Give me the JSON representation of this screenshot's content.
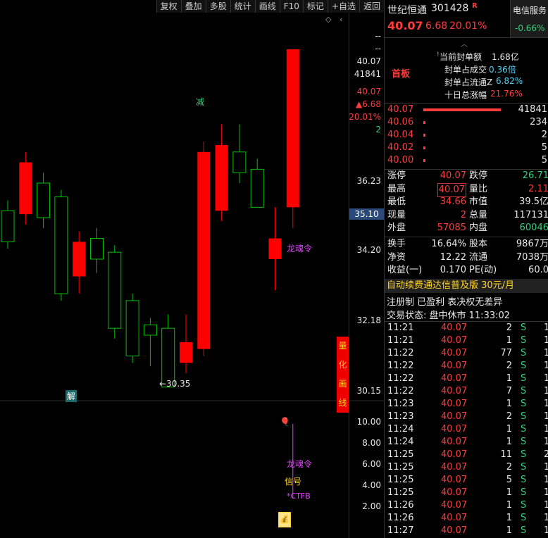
{
  "toolbar": {
    "items": [
      "复权",
      "叠加",
      "多股",
      "统计",
      "画线",
      "F10",
      "标记",
      "+自选",
      "返回"
    ]
  },
  "chart": {
    "axis_labels": [
      "--",
      "--",
      "40.07",
      "41841",
      "40.07",
      "▲6.68",
      "20.01%",
      "2",
      "36.23",
      "35.10",
      "34.20",
      "32.18",
      "30.15"
    ],
    "vol_axis": [
      "10.00",
      "8.00",
      "6.00",
      "4.00",
      "2.00"
    ],
    "annot_jian": "减",
    "annot_jie": "解",
    "low_marker": "←30.35",
    "dragon_label": "龙魂令",
    "dragon_label2": "龙魂令",
    "signal_label": "信号",
    "ctfb_label": "*CTFB",
    "quant_tag": [
      "量",
      "化",
      "画",
      "线"
    ],
    "colors": {
      "up": "#ff0000",
      "down": "#00c400",
      "bg": "#000000"
    }
  },
  "chart_data": {
    "type": "candlestick",
    "ylim": [
      30.15,
      40.07
    ],
    "candles": [
      {
        "o": 35.4,
        "c": 34.5,
        "h": 35.7,
        "l": 34.3
      },
      {
        "o": 35.3,
        "c": 36.8,
        "h": 37.1,
        "l": 35.0
      },
      {
        "o": 36.2,
        "c": 35.2,
        "h": 36.5,
        "l": 34.9
      },
      {
        "o": 35.8,
        "c": 33.0,
        "h": 36.0,
        "l": 32.8
      },
      {
        "o": 33.5,
        "c": 34.5,
        "h": 34.8,
        "l": 33.0
      },
      {
        "o": 34.6,
        "c": 34.0,
        "h": 34.9,
        "l": 33.6
      },
      {
        "o": 34.2,
        "c": 32.0,
        "h": 34.4,
        "l": 31.7
      },
      {
        "o": 32.8,
        "c": 31.2,
        "h": 33.0,
        "l": 31.0
      },
      {
        "o": 32.1,
        "c": 31.8,
        "h": 32.3,
        "l": 30.9
      },
      {
        "o": 32.0,
        "c": 30.3,
        "h": 32.4,
        "l": 30.35
      },
      {
        "o": 31.0,
        "c": 31.6,
        "h": 32.4,
        "l": 30.7
      },
      {
        "o": 31.4,
        "c": 37.1,
        "h": 37.4,
        "l": 31.2
      },
      {
        "o": 35.4,
        "c": 37.3,
        "h": 37.9,
        "l": 35.1
      },
      {
        "o": 37.1,
        "c": 36.5,
        "h": 37.9,
        "l": 36.2
      },
      {
        "o": 36.6,
        "c": 35.5,
        "h": 36.9,
        "l": 35.5
      },
      {
        "o": 34.0,
        "c": 34.6,
        "h": 35.5,
        "l": 33.1
      },
      {
        "o": 35.5,
        "c": 40.07,
        "h": 40.07,
        "l": 34.9
      }
    ]
  },
  "panel": {
    "stock_name": "世纪恒通",
    "stock_code": "301428",
    "r_badge": "R",
    "sector": "电信服务",
    "sector_pct": "-0.66%",
    "price": "40.07",
    "change": "6.68",
    "change_pct": "20.01%",
    "board_label": "首板",
    "seal": [
      {
        "label": "当前封单额",
        "value": "1.68亿"
      },
      {
        "label": "封单占成交",
        "value": "0.36倍"
      },
      {
        "label": "封单占流通Z",
        "value": "6.82%"
      },
      {
        "label": "十日总涨幅",
        "value": "21.76%"
      }
    ],
    "bids": [
      {
        "price": "40.07",
        "vol": "41841"
      },
      {
        "price": "40.06",
        "vol": "234"
      },
      {
        "price": "40.04",
        "vol": "2"
      },
      {
        "price": "40.02",
        "vol": "5"
      },
      {
        "price": "40.00",
        "vol": "5"
      }
    ],
    "stats": [
      {
        "l1": "涨停",
        "v1": "40.07",
        "l2": "跌停",
        "v2": "26.71"
      },
      {
        "l1": "最高",
        "v1": "40.07",
        "l2": "量比",
        "v2": "2.11"
      },
      {
        "l1": "最低",
        "v1": "34.66",
        "l2": "市值",
        "v2": "39.5亿"
      },
      {
        "l1": "现量",
        "v1": "2",
        "l2": "总量",
        "v2": "117131"
      },
      {
        "l1": "外盘",
        "v1": "57085",
        "l2": "内盘",
        "v2": "60046"
      }
    ],
    "stats2": [
      {
        "l1": "换手",
        "v1": "16.64%",
        "l2": "股本",
        "v2": "9867万"
      },
      {
        "l1": "净资",
        "v1": "12.22",
        "l2": "流通",
        "v2": "7038万"
      },
      {
        "l1": "收益(一)",
        "v1": "0.170",
        "l2": "PE(动)",
        "v2": "60.0"
      }
    ],
    "promo": "自动续费通达信普及版 30元/月",
    "reg": "注册制 已盈利 表决权无差异",
    "trade_status": "交易状态: 盘中休市 11:33:02",
    "ticks": [
      {
        "t": "11:21",
        "p": "40.07",
        "v": "2",
        "s": "S",
        "n": "1"
      },
      {
        "t": "11:21",
        "p": "40.07",
        "v": "1",
        "s": "S",
        "n": "1"
      },
      {
        "t": "11:22",
        "p": "40.07",
        "v": "77",
        "s": "S",
        "n": "1"
      },
      {
        "t": "11:22",
        "p": "40.07",
        "v": "2",
        "s": "S",
        "n": "1"
      },
      {
        "t": "11:22",
        "p": "40.07",
        "v": "1",
        "s": "S",
        "n": "1"
      },
      {
        "t": "11:22",
        "p": "40.07",
        "v": "7",
        "s": "S",
        "n": "1"
      },
      {
        "t": "11:23",
        "p": "40.07",
        "v": "1",
        "s": "S",
        "n": "1"
      },
      {
        "t": "11:23",
        "p": "40.07",
        "v": "2",
        "s": "S",
        "n": "1"
      },
      {
        "t": "11:24",
        "p": "40.07",
        "v": "1",
        "s": "S",
        "n": "1"
      },
      {
        "t": "11:24",
        "p": "40.07",
        "v": "1",
        "s": "S",
        "n": "1"
      },
      {
        "t": "11:25",
        "p": "40.07",
        "v": "11",
        "s": "S",
        "n": "2"
      },
      {
        "t": "11:25",
        "p": "40.07",
        "v": "2",
        "s": "S",
        "n": "1"
      },
      {
        "t": "11:25",
        "p": "40.07",
        "v": "5",
        "s": "S",
        "n": "1"
      },
      {
        "t": "11:25",
        "p": "40.07",
        "v": "1",
        "s": "S",
        "n": "1"
      },
      {
        "t": "11:26",
        "p": "40.07",
        "v": "1",
        "s": "S",
        "n": "1"
      },
      {
        "t": "11:26",
        "p": "40.07",
        "v": "1",
        "s": "S",
        "n": "1"
      },
      {
        "t": "11:27",
        "p": "40.07",
        "v": "1",
        "s": "S",
        "n": "1"
      }
    ]
  }
}
